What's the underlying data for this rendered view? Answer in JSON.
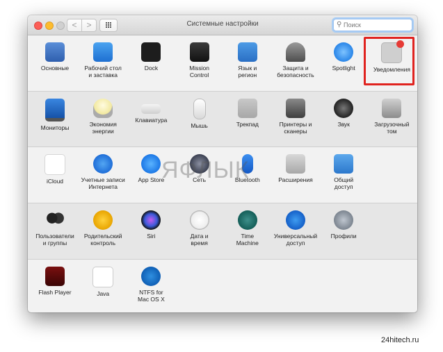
{
  "window": {
    "title": "Системные настройки"
  },
  "search": {
    "placeholder": "Поиск"
  },
  "nav": {
    "back": "<",
    "forward": ">"
  },
  "rows": [
    [
      {
        "label": "Основные",
        "icon": "general-icon"
      },
      {
        "label": "Рабочий стол\nи заставка",
        "icon": "desktop-screensaver-icon"
      },
      {
        "label": "Dock",
        "icon": "dock-icon"
      },
      {
        "label": "Mission\nControl",
        "icon": "mission-control-icon"
      },
      {
        "label": "Язык и\nрегион",
        "icon": "language-region-icon"
      },
      {
        "label": "Защита и\nбезопасность",
        "icon": "security-icon"
      },
      {
        "label": "Spotlight",
        "icon": "spotlight-icon"
      },
      {
        "label": "Уведомления",
        "icon": "notifications-icon"
      }
    ],
    [
      {
        "label": "Мониторы",
        "icon": "displays-icon"
      },
      {
        "label": "Экономия\nэнергии",
        "icon": "energy-saver-icon"
      },
      {
        "label": "Клавиатура",
        "icon": "keyboard-icon"
      },
      {
        "label": "Мышь",
        "icon": "mouse-icon"
      },
      {
        "label": "Трекпад",
        "icon": "trackpad-icon"
      },
      {
        "label": "Принтеры и\nсканеры",
        "icon": "printers-icon"
      },
      {
        "label": "Звук",
        "icon": "sound-icon"
      },
      {
        "label": "Загрузочный\nтом",
        "icon": "startup-disk-icon"
      }
    ],
    [
      {
        "label": "iCloud",
        "icon": "icloud-icon"
      },
      {
        "label": "Учетные записи\nИнтернета",
        "icon": "internet-accounts-icon"
      },
      {
        "label": "App Store",
        "icon": "app-store-icon"
      },
      {
        "label": "Сеть",
        "icon": "network-icon"
      },
      {
        "label": "Bluetooth",
        "icon": "bluetooth-icon"
      },
      {
        "label": "Расширения",
        "icon": "extensions-icon"
      },
      {
        "label": "Общий\nдоступ",
        "icon": "sharing-icon"
      }
    ],
    [
      {
        "label": "Пользователи\nи группы",
        "icon": "users-groups-icon"
      },
      {
        "label": "Родительский\nконтроль",
        "icon": "parental-controls-icon"
      },
      {
        "label": "Siri",
        "icon": "siri-icon"
      },
      {
        "label": "Дата и\nвремя",
        "icon": "date-time-icon"
      },
      {
        "label": "Time\nMachine",
        "icon": "time-machine-icon"
      },
      {
        "label": "Универсальный\nдоступ",
        "icon": "accessibility-icon"
      },
      {
        "label": "Профили",
        "icon": "profiles-icon"
      }
    ],
    [
      {
        "label": "Flash Player",
        "icon": "flash-player-icon"
      },
      {
        "label": "Java",
        "icon": "java-icon"
      },
      {
        "label": "NTFS for\nMac OS X",
        "icon": "ntfs-icon"
      }
    ]
  ],
  "watermark": "ЯФЛЫК",
  "site": "24hitech.ru",
  "colors": {
    "highlight": "#e0231f",
    "notification_dot": "#e63a35"
  }
}
